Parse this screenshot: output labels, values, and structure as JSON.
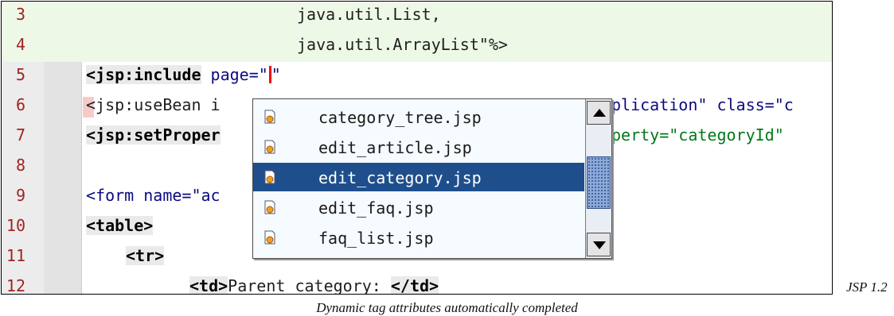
{
  "editor": {
    "lines": [
      {
        "number": "3",
        "text": "java.util.List,"
      },
      {
        "number": "4",
        "text": "java.util.ArrayList\"%>"
      },
      {
        "number": "5",
        "tag": "<jsp:include",
        "attr": "page=\"",
        "tail": "\""
      },
      {
        "number": "6",
        "text": "<jsp:useBean i",
        "right": "plication\" class=\"c"
      },
      {
        "number": "7",
        "tag": "<jsp:setProper",
        "right": "perty=\"categoryId\""
      },
      {
        "number": "8",
        "text": ""
      },
      {
        "number": "9",
        "text": "<form name=\"ac"
      },
      {
        "number": "10",
        "tag": "<table>"
      },
      {
        "number": "11",
        "tag": "<tr>"
      },
      {
        "number": "12",
        "tag_open": "<td>",
        "text": "Parent category: ",
        "tag_close": "</td>"
      }
    ]
  },
  "completion": {
    "items": [
      {
        "label": "category_tree.jsp",
        "icon": "jsp-file-icon"
      },
      {
        "label": "edit_article.jsp",
        "icon": "jsp-file-icon"
      },
      {
        "label": "edit_category.jsp",
        "icon": "jsp-file-icon",
        "selected": true
      },
      {
        "label": "edit_faq.jsp",
        "icon": "jsp-file-icon"
      },
      {
        "label": "faq_list.jsp",
        "icon": "jsp-file-icon"
      }
    ]
  },
  "version_label": "JSP 1.2",
  "caption": "Dynamic tag attributes automatically completed"
}
